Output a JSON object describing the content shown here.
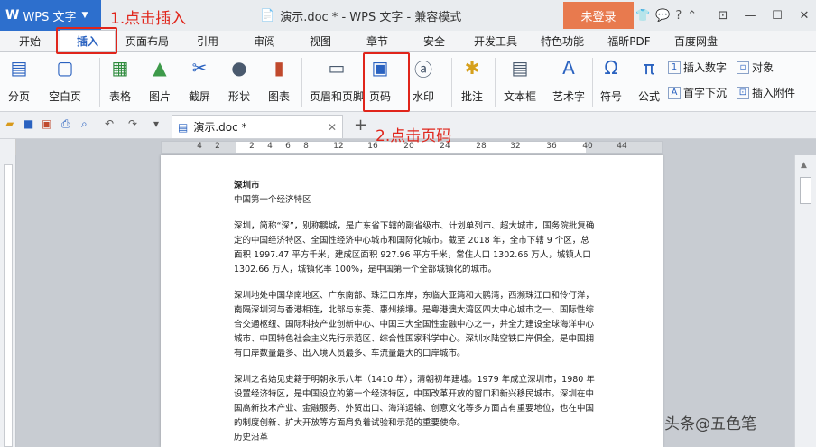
{
  "titlebar": {
    "app_logo": "W",
    "app_name": "WPS 文字",
    "doc_title": "演示.doc * - WPS 文字 - 兼容模式",
    "login": "未登录",
    "icons": [
      "shirt-icon",
      "chat-icon",
      "help-icon",
      "chevron-up-icon"
    ],
    "window_controls": [
      "restore-icon",
      "minimize-icon",
      "maximize-icon",
      "close-icon"
    ]
  },
  "tabs": [
    "开始",
    "插入",
    "页面布局",
    "引用",
    "审阅",
    "视图",
    "章节",
    "安全",
    "开发工具",
    "特色功能",
    "福昕PDF",
    "百度网盘"
  ],
  "active_tab": "插入",
  "ribbon": {
    "buttons": [
      "分页",
      "空白页",
      "表格",
      "图片",
      "截屏",
      "形状",
      "图表",
      "页眉和页脚",
      "页码",
      "水印",
      "批注",
      "文本框",
      "艺术字",
      "符号",
      "公式"
    ],
    "small_buttons": [
      "插入数字",
      "对象",
      "首字下沉",
      "插入附件"
    ]
  },
  "quick_access": {
    "doc_tab": "演示.doc *",
    "new_tab": "+"
  },
  "ruler": {
    "ticks": [
      "4",
      "2",
      "2",
      "4",
      "6",
      "8",
      "12",
      "16",
      "20",
      "24",
      "28",
      "32",
      "36",
      "40",
      "44"
    ]
  },
  "document": {
    "title": "深圳市",
    "subtitle": "中国第一个经济特区",
    "paragraphs": [
      "深圳，简称“深”，别称鹏城，是广东省下辖的副省级市、计划单列市、超大城市，国务院批复确定的中国经济特区、全国性经济中心城市和国际化城市。截至 2018 年，全市下辖 9 个区，总面积 1997.47 平方千米，建成区面积 927.96 平方千米，常住人口 1302.66 万人，城镇人口 1302.66 万人，城镇化率 100%，是中国第一个全部城镇化的城市。",
      "深圳地处中国华南地区、广东南部、珠江口东岸，东临大亚湾和大鹏湾，西濒珠江口和伶仃洋，南隔深圳河与香港相连，北部与东莞、惠州接壤。是粤港澳大湾区四大中心城市之一、国际性综合交通枢纽、国际科技产业创新中心、中国三大全国性金融中心之一，并全力建设全球海洋中心城市、中国特色社会主义先行示范区、综合性国家科学中心。深圳水陆空铁口岸俱全，是中国拥有口岸数量最多、出入境人员最多、车流量最大的口岸城市。",
      "深圳之名始见史籍于明朝永乐八年（1410 年），清朝初年建墟。1979 年成立深圳市，1980 年设置经济特区，是中国设立的第一个经济特区，中国改革开放的窗口和新兴移民城市。深圳在中国高新技术产业、金融服务、外贸出口、海洋运输、创意文化等多方面占有重要地位，也在中国的制度创新、扩大开放等方面肩负着试验和示范的重要使命。"
    ],
    "section_heading": "历史沿革"
  },
  "annotations": {
    "step1": "1.点击插入",
    "step2": "2.点击页码",
    "watermark": "头条@五色笔"
  },
  "colors": {
    "accent": "#2d6fcd",
    "login_bg": "#e87a4e",
    "annotation_red": "#e0251b"
  }
}
